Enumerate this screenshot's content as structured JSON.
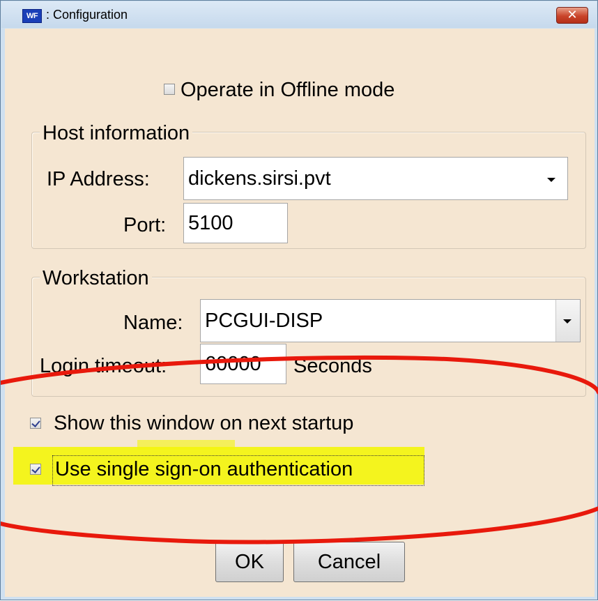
{
  "window": {
    "app_icon_text": "WF",
    "title": ": Configuration",
    "close_glyph": "✕"
  },
  "offline": {
    "label": "Operate in Offline mode",
    "checked": false
  },
  "host": {
    "legend": "Host information",
    "ip_label": "IP Address:",
    "ip_value": "dickens.sirsi.pvt",
    "port_label": "Port:",
    "port_value": "5100"
  },
  "workstation": {
    "legend": "Workstation",
    "name_label": "Name:",
    "name_value": "PCGUI-DISP",
    "timeout_label": "Login timeout:",
    "timeout_value": "60000",
    "timeout_unit": "Seconds"
  },
  "options": {
    "show_startup_label": "Show this window on next startup",
    "show_startup_checked": true,
    "sso_label": "Use single sign-on authentication",
    "sso_checked": true
  },
  "buttons": {
    "ok": "OK",
    "cancel": "Cancel"
  },
  "annotations": {
    "ellipse_color": "#e8190c",
    "highlight_color": "#f4f50a"
  },
  "icons": [
    "close-icon",
    "app-icon",
    "dropdown-arrow-icon",
    "checkbox-icon"
  ]
}
